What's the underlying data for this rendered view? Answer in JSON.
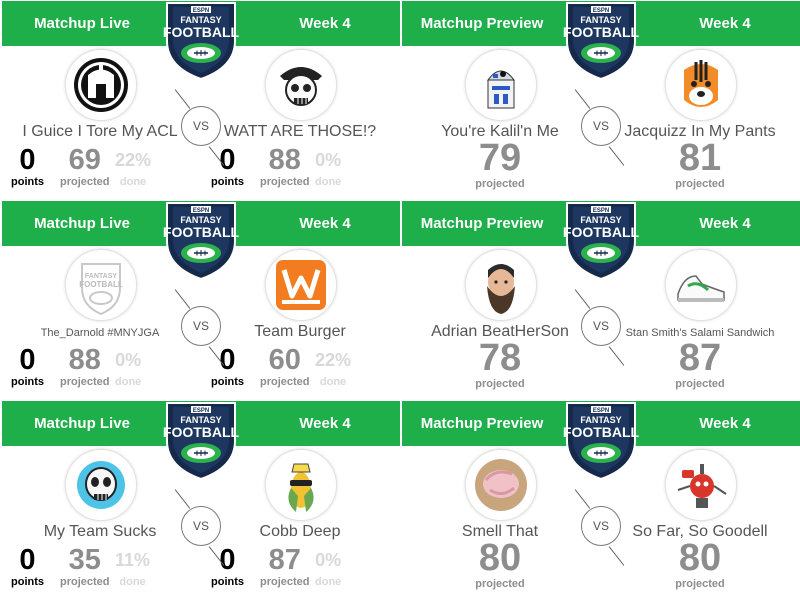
{
  "labels": {
    "vs": "VS",
    "points": "points",
    "projected": "projected",
    "done": "done"
  },
  "logo": {
    "brand": "ESPN",
    "line1": "FANTASY",
    "line2": "FOOTBALL"
  },
  "colors": {
    "header_green": "#1eae4a",
    "logo_navy": "#15294a",
    "logo_green": "#2cb24a"
  },
  "cards": [
    {
      "mode": "live",
      "title": "Matchup Live",
      "week": "Week 4",
      "home": {
        "name": "I Guice I Tore My ACL",
        "icon": "spartan-helmet-icon",
        "points": "0",
        "projected": "69",
        "done": "22%"
      },
      "away": {
        "name": "WATT ARE THOSE!?",
        "icon": "pirate-skull-icon",
        "points": "0",
        "projected": "88",
        "done": "0%"
      }
    },
    {
      "mode": "preview",
      "title": "Matchup Preview",
      "week": "Week 4",
      "home": {
        "name": "You're Kalil'n Me",
        "icon": "r2d2-robot-icon",
        "projected": "79"
      },
      "away": {
        "name": "Jacquizz In My Pants",
        "icon": "tiger-football-icon",
        "projected": "81"
      }
    },
    {
      "mode": "live",
      "title": "Matchup Live",
      "week": "Week 4",
      "home": {
        "name": "The_Darnold #MNYJGA",
        "icon": "fantasy-football-logo-icon",
        "points": "0",
        "projected": "88",
        "done": "0%"
      },
      "away": {
        "name": "Team Burger",
        "icon": "whataburger-logo-icon",
        "points": "0",
        "projected": "60",
        "done": "22%"
      }
    },
    {
      "mode": "preview",
      "title": "Matchup Preview",
      "week": "Week 4",
      "home": {
        "name": "Adrian BeatHerSon",
        "icon": "bearded-man-icon",
        "projected": "78"
      },
      "away": {
        "name": "Stan Smith's Salami Sandwich",
        "icon": "sneaker-icon",
        "projected": "87"
      }
    },
    {
      "mode": "live",
      "title": "Matchup Live",
      "week": "Week 4",
      "home": {
        "name": "My Team Sucks",
        "icon": "blue-skull-icon",
        "points": "0",
        "projected": "35",
        "done": "11%"
      },
      "away": {
        "name": "Cobb Deep",
        "icon": "corn-cob-icon",
        "points": "0",
        "projected": "87",
        "done": "0%"
      }
    },
    {
      "mode": "preview",
      "title": "Matchup Preview",
      "week": "Week 4",
      "home": {
        "name": "Smell That",
        "icon": "pink-hand-icon",
        "projected": "80"
      },
      "away": {
        "name": "So Far, So Goodell",
        "icon": "red-robot-icon",
        "projected": "80"
      }
    }
  ]
}
